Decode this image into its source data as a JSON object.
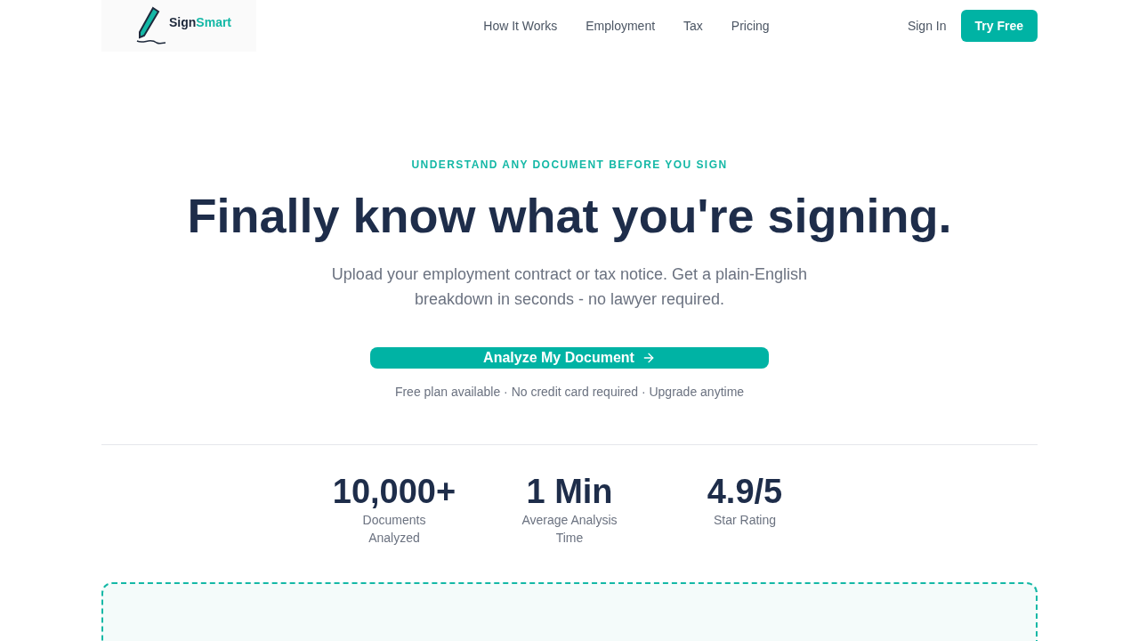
{
  "logo": {
    "text_dark": "Sign",
    "text_accent": "Smart"
  },
  "nav": [
    {
      "label": "How It Works"
    },
    {
      "label": "Employment"
    },
    {
      "label": "Tax"
    },
    {
      "label": "Pricing"
    }
  ],
  "sign_in": "Sign In",
  "try_free": "Try Free",
  "eyebrow": "UNDERSTAND ANY DOCUMENT BEFORE YOU SIGN",
  "headline": "Finally know what you're signing.",
  "subtitle": "Upload your employment contract or tax notice. Get a plain-English breakdown in seconds - no lawyer required.",
  "cta": "Analyze My Document",
  "note": "Free plan available · No credit card required · Upgrade anytime",
  "stats": [
    {
      "value": "10,000+",
      "label": "Documents Analyzed"
    },
    {
      "value": "1 Min",
      "label": "Average Analysis Time"
    },
    {
      "value": "4.9/5",
      "label": "Star Rating"
    }
  ]
}
